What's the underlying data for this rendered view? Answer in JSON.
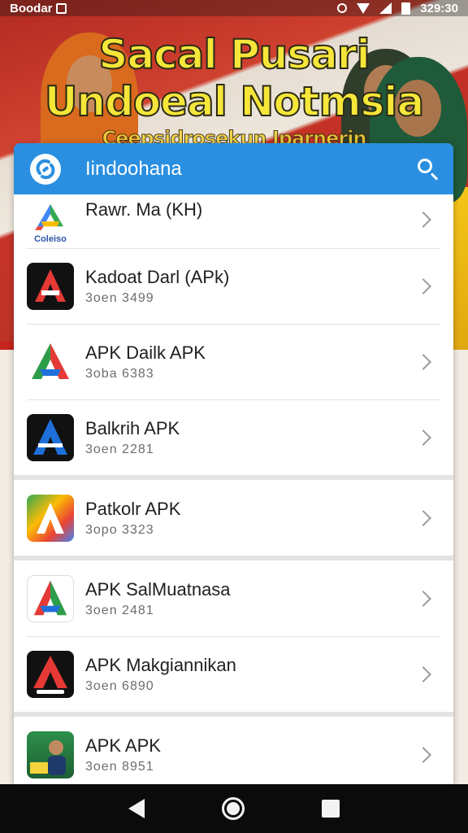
{
  "status_bar": {
    "left_text": "Boodar",
    "time": "329:30"
  },
  "poster": {
    "line1": "Sacal Pusari",
    "line2": "Undoeal Notmsia",
    "line3": "Ceepsidrosekun Iparnerin"
  },
  "app_bar": {
    "title": "Iindoohana"
  },
  "apps": [
    {
      "name": "Rawr. Ma (KH)",
      "sub": "",
      "icon": "google-style-a-logo",
      "icon_caption": "Coleiso"
    },
    {
      "name": "Kadoat Darl (APk)",
      "sub": "3oen 3499",
      "icon": "red-a-logo-dark"
    },
    {
      "name": "APK Dailk APK",
      "sub": "3oba 6383",
      "icon": "green-red-a-logo"
    },
    {
      "name": "Balkrih APK",
      "sub": "3oen 2281",
      "icon": "blue-a-logo-dark"
    },
    {
      "name": "Patkolr APK",
      "sub": "3opo 3323",
      "icon": "rainbow-a-logo"
    },
    {
      "name": "APK SalMuatnasa",
      "sub": "3oen 2481",
      "icon": "red-green-a-logo"
    },
    {
      "name": "APK Makgiannikan",
      "sub": "3oen 6890",
      "icon": "red-a-logo-dark-2"
    },
    {
      "name": "APK APK",
      "sub": "3oen 8951",
      "icon": "photo-app-icon"
    }
  ],
  "colors": {
    "app_bar": "#2a8fe0",
    "nav_bar": "#0b0b0b"
  }
}
